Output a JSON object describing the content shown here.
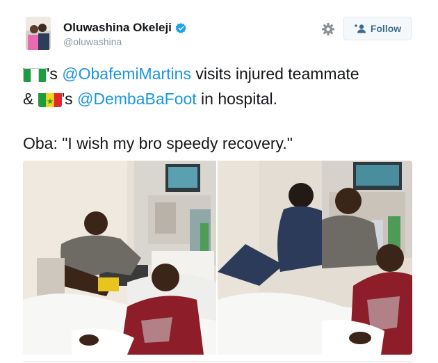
{
  "user": {
    "display_name": "Oluwashina Okeleji",
    "handle": "@oluwashina",
    "verified": true
  },
  "actions": {
    "follow_label": "Follow",
    "settings_icon": "gear-icon"
  },
  "tweet": {
    "line1": {
      "flag": "nigeria-flag",
      "after_flag": "'s ",
      "mention": "@ObafemiMartins",
      "after_mention": " visits injured teammate"
    },
    "line2": {
      "prefix": "& ",
      "flag": "senegal-flag",
      "after_flag": "'s ",
      "mention": "@DembaBaFoot",
      "after_mention": " in hospital."
    },
    "line3": "Oba: \"I wish my bro speedy recovery.\""
  },
  "colors": {
    "link": "#1b95e0",
    "verified_badge": "#1da1f2",
    "handle": "#8899a6",
    "follow_text": "#3b6b8f"
  }
}
